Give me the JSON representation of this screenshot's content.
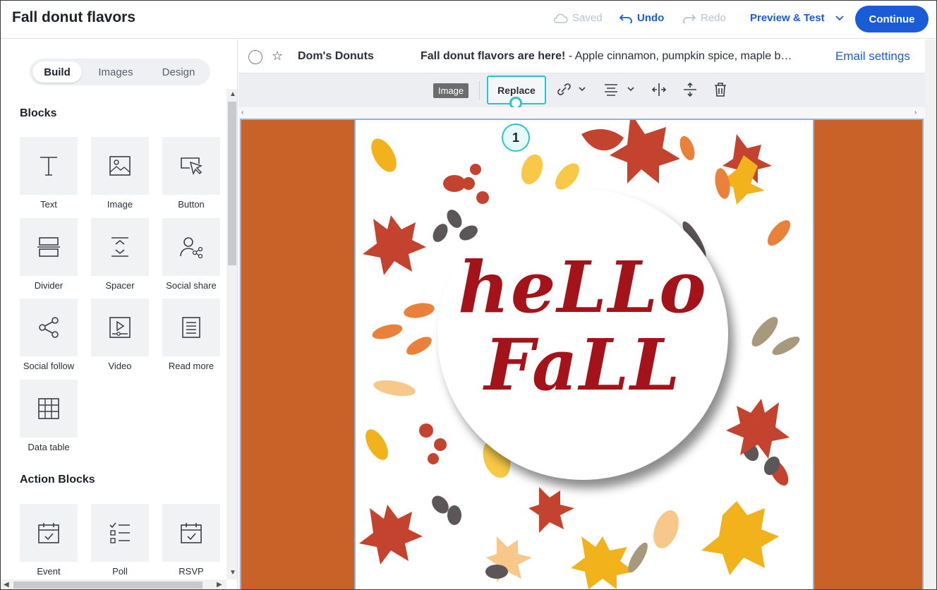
{
  "header": {
    "title": "Fall donut flavors",
    "saved": "Saved",
    "undo": "Undo",
    "redo": "Redo",
    "preview": "Preview & Test",
    "continue": "Continue"
  },
  "sidebar": {
    "tabs": [
      "Build",
      "Images",
      "Design"
    ],
    "blocks_title": "Blocks",
    "blocks": [
      "Text",
      "Image",
      "Button",
      "Divider",
      "Spacer",
      "Social share",
      "Social follow",
      "Video",
      "Read more",
      "Data table"
    ],
    "action_title": "Action Blocks",
    "actions": [
      "Event",
      "Poll",
      "RSVP"
    ]
  },
  "email": {
    "sender": "Dom's Donuts",
    "subject_bold": "Fall donut flavors are here!",
    "subject_rest": " - Apple cinnamon, pumpkin spice, maple b…",
    "settings": "Email settings"
  },
  "toolbar": {
    "badge": "Image",
    "replace": "Replace",
    "callout": "1"
  },
  "image": {
    "line1": "heLLo",
    "line2": "FaLL"
  },
  "colors": {
    "accent": "#1a5bd8",
    "callout": "#2ec4c4",
    "stage": "#c96229",
    "text_red": "#a4121a"
  }
}
